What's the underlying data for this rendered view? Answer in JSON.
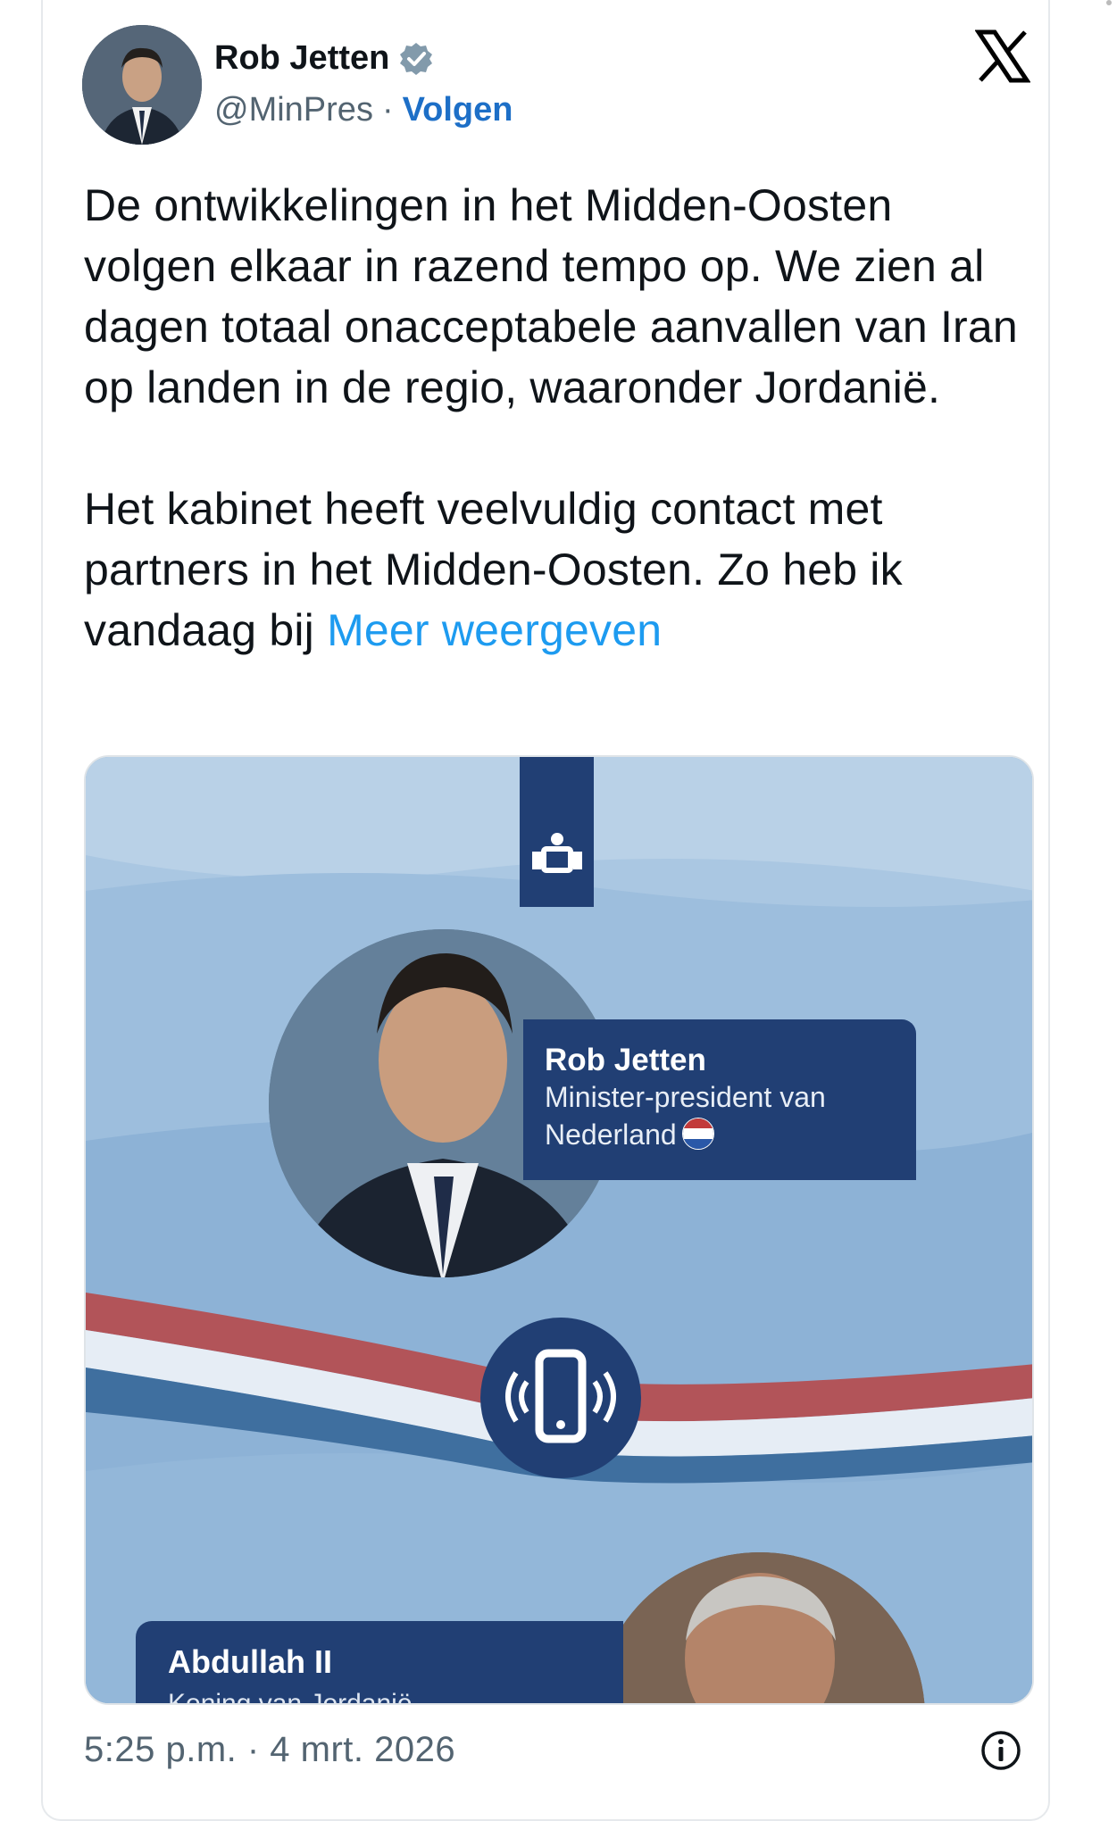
{
  "tweet": {
    "author_name": "Rob Jetten",
    "handle": "@MinPres",
    "separator": "·",
    "follow_label": "Volgen",
    "paragraph_1": "De ontwikkelingen in het Midden-Oosten volgen elkaar in razend tempo op. We zien al dagen totaal onacceptabele aanvallen van Iran op landen in de regio, waaronder Jordanië.",
    "paragraph_2_start": "Het kabinet heeft veelvuldig contact met partners in het Midden-Oosten. Zo heb ik vandaag bij ",
    "show_more": "Meer weergeven",
    "timestamp": "5:25 p.m. · 4 mrt. 2026"
  },
  "media": {
    "person_1_name": "Rob Jetten",
    "person_1_role": "Minister-president van Nederland",
    "person_2_name": "Abdullah II",
    "person_2_role": "Koning van Jordanië"
  },
  "icons": {
    "verified": "verified-badge-icon",
    "x_logo": "x-logo-icon",
    "phone": "phone-call-icon",
    "info": "info-icon",
    "flag": "netherlands-flag-icon"
  },
  "colors": {
    "link": "#1d9bf0",
    "follow": "#1d6fc7",
    "navy": "#213f74",
    "text": "#0f1419",
    "muted": "#536471"
  }
}
